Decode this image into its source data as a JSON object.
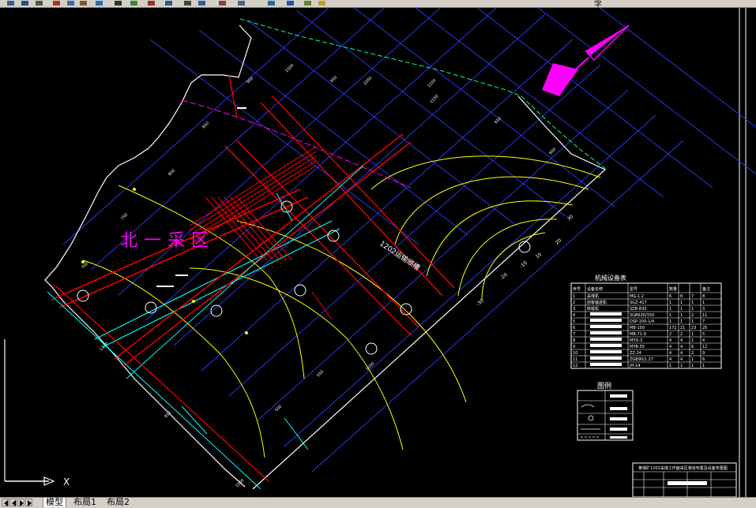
{
  "app": {
    "name": "CAD drawing viewer",
    "accent_color": "#ffffff"
  },
  "toolbar": {
    "icons": [
      "folder-open-icon",
      "save-icon",
      "print-icon",
      "cut-icon",
      "copy-icon",
      "paste-icon",
      "undo-icon",
      "zoom-icon",
      "layer-icon",
      "properties-icon",
      "pan-icon",
      "zoom-window-icon",
      "zoom-previous-icon",
      "text-style-icon",
      "dim-style-icon",
      "tool-palette-icon",
      "help-icon",
      "layer-state-icon",
      "color-icon"
    ],
    "font_label": "字"
  },
  "drawing": {
    "area_label": "北一采区",
    "roadway_label": "1202运输顺槽",
    "contour_labels": [
      "30",
      "20",
      "10",
      "-10",
      "-20",
      "-30"
    ],
    "grid_labels": [
      "900",
      "1000",
      "950",
      "1050",
      "1100",
      "850",
      "800",
      "1150",
      "750",
      "700",
      "650",
      "600",
      "500",
      "550",
      "950",
      "1000",
      "1050",
      "1100"
    ],
    "colors": {
      "grid": "#2a3bff",
      "roadway": "#ff0000",
      "contour": "#ffff00",
      "boundary": "#ffffff",
      "goaf_line": "#00ff00",
      "magenta": "#ff00ff",
      "cyan": "#00ffff"
    }
  },
  "equipment_table": {
    "title": "机械设备表",
    "headers": [
      "序号",
      "设备名称",
      "型号",
      "数量",
      "",
      "",
      "备注"
    ],
    "rows": [
      [
        "1",
        "采煤机",
        "MG-1.2",
        "6",
        "8",
        "7",
        "8"
      ],
      [
        "2",
        "刮板输送机",
        "SGZ-417",
        "1",
        "1",
        "1",
        "1"
      ],
      [
        "3",
        "转载机",
        "SZB-830",
        "1",
        "1",
        "1",
        "3"
      ],
      [
        "4",
        "",
        "SGB630/150",
        "1",
        "1",
        "2",
        "11"
      ],
      [
        "5",
        "",
        "DSP-100-1/4",
        "1",
        "1",
        "1",
        "7"
      ],
      [
        "6",
        "",
        "MB-150",
        "172",
        "21",
        "23",
        "25"
      ],
      [
        "7",
        "",
        "MB-71-9",
        "2",
        "2",
        "1",
        "5"
      ],
      [
        "8",
        "",
        "MYD-3",
        "4",
        "4",
        "1",
        "4"
      ],
      [
        "9",
        "",
        "MYB-55",
        "4",
        "4",
        "6",
        "12"
      ],
      [
        "10",
        "",
        "ZZ-24",
        "4",
        "4",
        "2",
        "9"
      ],
      [
        "11",
        "",
        "ZGB90/1.27",
        "4",
        "4",
        "1",
        "6"
      ],
      [
        "12",
        "",
        "JH-14",
        "1",
        "1",
        "1",
        "1"
      ]
    ]
  },
  "legend": {
    "title": "图例"
  },
  "title_block": {
    "title": "某煤矿1202采煤工作面采区巷道布置及设备布置图"
  },
  "axis_indicator": {
    "x_label": "X"
  },
  "tabs": [
    {
      "label": "模型",
      "active": true
    },
    {
      "label": "布局1",
      "active": false
    },
    {
      "label": "布局2",
      "active": false
    }
  ]
}
